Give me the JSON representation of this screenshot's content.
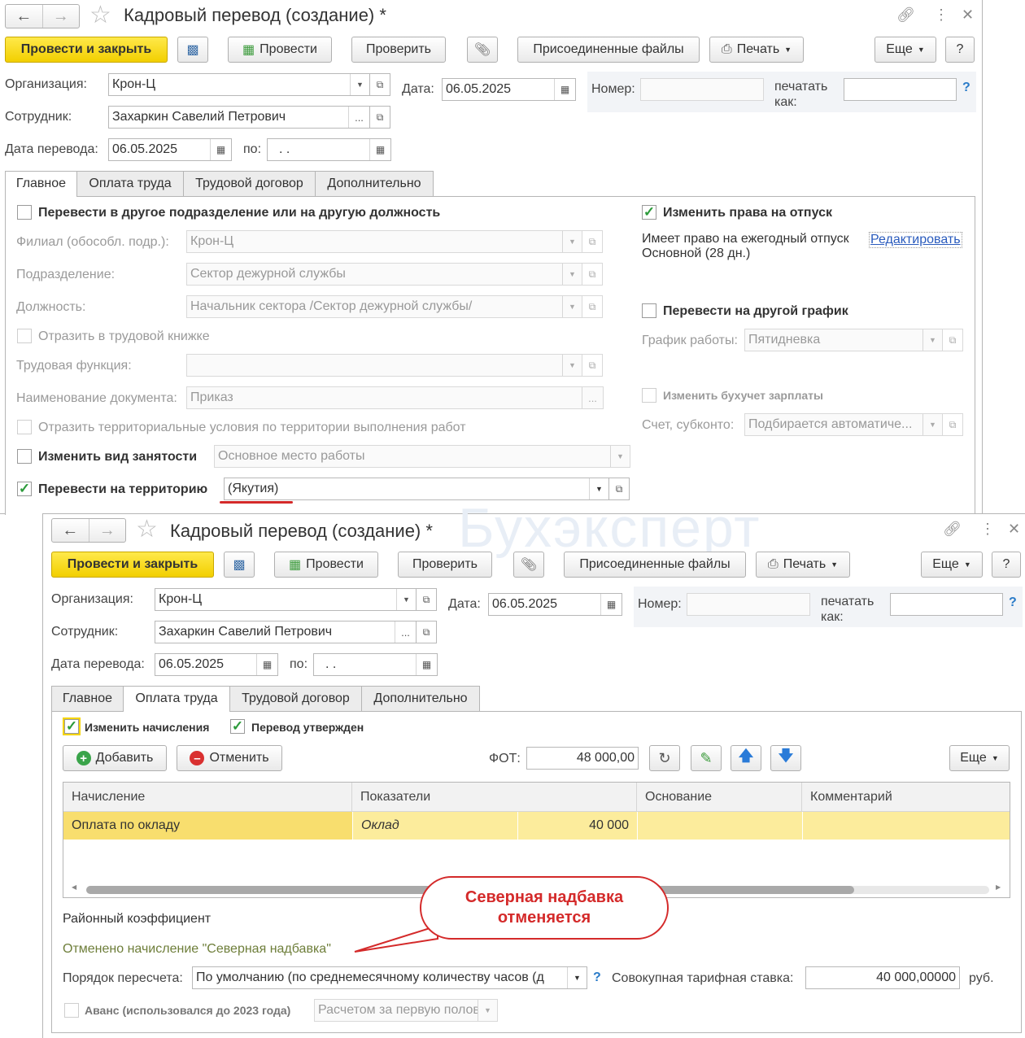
{
  "win1": {
    "title": "Кадровый перевод (создание) *",
    "toolbar": {
      "post_close": "Провести и закрыть",
      "post": "Провести",
      "check": "Проверить",
      "attached": "Присоединенные файлы",
      "print": "Печать",
      "more": "Еще",
      "help": "?"
    },
    "org_label": "Организация:",
    "org_value": "Крон-Ц",
    "date_label": "Дата:",
    "date_value": "06.05.2025",
    "number_label": "Номер:",
    "print_as_label": "печатать как:",
    "employee_label": "Сотрудник:",
    "employee_value": "Захаркин Савелий Петрович",
    "transfer_date_label": "Дата перевода:",
    "transfer_date_value": "06.05.2025",
    "to_label": "по:",
    "to_value": " .  .",
    "tabs": [
      "Главное",
      "Оплата труда",
      "Трудовой договор",
      "Дополнительно"
    ],
    "main": {
      "transfer_dept": "Перевести в другое подразделение или на другую должность",
      "branch_label": "Филиал (обособл. подр.):",
      "branch_value": "Крон-Ц",
      "dept_label": "Подразделение:",
      "dept_value": "Сектор дежурной службы",
      "position_label": "Должность:",
      "position_value": "Начальник сектора /Сектор дежурной службы/",
      "workbook": "Отразить в трудовой книжке",
      "labor_function_label": "Трудовая функция:",
      "doc_name_label": "Наименование документа:",
      "doc_name_value": "Приказ",
      "territorial": "Отразить территориальные условия по территории выполнения работ",
      "employment_type": "Изменить вид занятости",
      "employment_type_value": "Основное место работы",
      "territory": "Перевести на территорию",
      "territory_value": "(Якутия)",
      "vacation_rights": "Изменить права на отпуск",
      "vacation_text": "Имеет право на ежегодный отпуск",
      "vacation_link": "Редактировать",
      "vacation_basic": "Основной (28 дн.)",
      "schedule": "Перевести на другой график",
      "schedule_label": "График работы:",
      "schedule_value": "Пятидневка",
      "accounting": "Изменить бухучет зарплаты",
      "account_label": "Счет, субконто:",
      "account_value": "Подбирается автоматиче..."
    }
  },
  "win2": {
    "title": "Кадровый перевод (создание) *",
    "toolbar": {
      "post_close": "Провести и закрыть",
      "post": "Провести",
      "check": "Проверить",
      "attached": "Присоединенные файлы",
      "print": "Печать",
      "more": "Еще",
      "help": "?"
    },
    "org_label": "Организация:",
    "org_value": "Крон-Ц",
    "date_label": "Дата:",
    "date_value": "06.05.2025",
    "number_label": "Номер:",
    "print_as_label": "печатать как:",
    "employee_label": "Сотрудник:",
    "employee_value": "Захаркин Савелий Петрович",
    "transfer_date_label": "Дата перевода:",
    "transfer_date_value": "06.05.2025",
    "to_label": "по:",
    "to_value": " .  .",
    "tabs": [
      "Главное",
      "Оплата труда",
      "Трудовой договор",
      "Дополнительно"
    ],
    "pay": {
      "change_accruals": "Изменить начисления",
      "transfer_approved": "Перевод утвержден",
      "add": "Добавить",
      "cancel": "Отменить",
      "fot_label": "ФОТ:",
      "fot_value": "48 000,00",
      "more": "Еще",
      "columns": [
        "Начисление",
        "Показатели",
        "Основание",
        "Комментарий"
      ],
      "row": {
        "accrual": "Оплата по окладу",
        "indicator": "Оклад",
        "amount": "40 000"
      },
      "regional_coef": "Районный коэффициент",
      "canceled_note": "Отменено начисление \"Северная надбавка\"",
      "recalc_label": "Порядок пересчета:",
      "recalc_value": "По умолчанию (по среднемесячному количеству часов (д",
      "tariff_label": "Совокупная тарифная ставка:",
      "tariff_value": "40 000,00000",
      "tariff_unit": "руб.",
      "advance": "Аванс (использовался до 2023 года)",
      "advance_value": "Расчетом за первую полови"
    }
  },
  "callout": {
    "line1": "Северная надбавка",
    "line2": "отменяется"
  },
  "watermark": "Бухэксперт",
  "colors": {
    "accent_yellow": "#f5d400",
    "check_green": "#2c9a3a",
    "callout_red": "#d42a2a",
    "row_highlight": "#fcec9c",
    "link_blue": "#2a5bbd"
  }
}
